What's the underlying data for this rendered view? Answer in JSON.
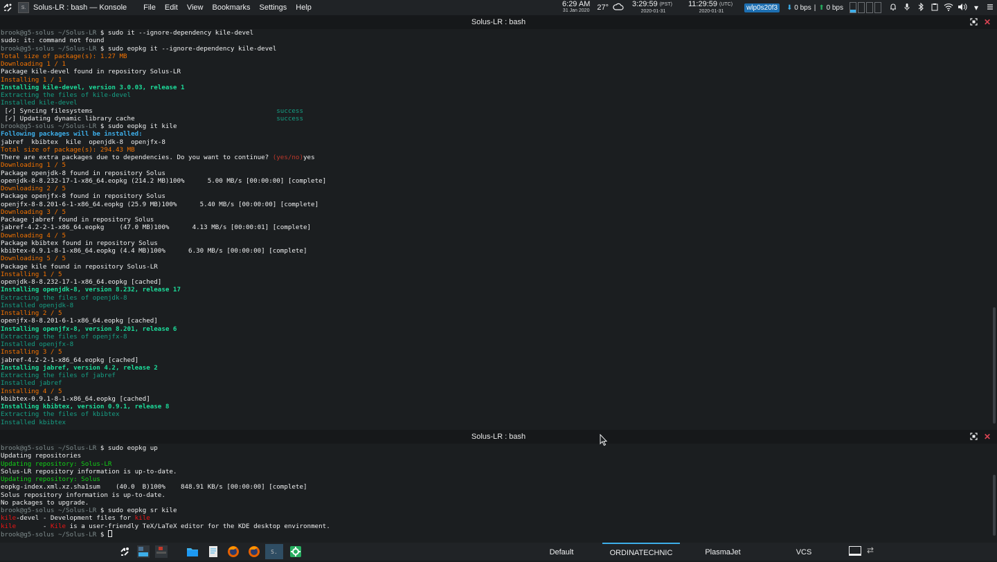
{
  "top_panel": {
    "app_badge": "S.",
    "window_title": "Solus-LR : bash — Konsole",
    "menu": [
      "File",
      "Edit",
      "View",
      "Bookmarks",
      "Settings",
      "Help"
    ],
    "clock_local": {
      "time": "6:29 AM",
      "date": "31 Jan 2020"
    },
    "temperature": "27°",
    "clock_pst": {
      "time": "3:29:59",
      "tz": "(PST)",
      "date": "2020-01-31"
    },
    "clock_utc": {
      "time": "11:29:59",
      "tz": "(UTC)",
      "date": "2020-01-31"
    },
    "interface": "wlp0s20f3",
    "down_speed": "0 bps",
    "separator": "|",
    "up_speed": "0 bps",
    "meters": [
      0.3,
      0.0,
      0.0,
      0.0
    ]
  },
  "pane1": {
    "title": "Solus-LR : bash",
    "lines": [
      [
        {
          "c": "gray",
          "t": "brook@g5-solus"
        },
        {
          "c": "gray",
          "t": " ~/Solus-LR "
        },
        {
          "c": "white",
          "t": "$ sudo it --ignore-dependency kile-devel"
        }
      ],
      [
        {
          "c": "white",
          "t": "sudo: it: command not found"
        }
      ],
      [
        {
          "c": "gray",
          "t": "brook@g5-solus"
        },
        {
          "c": "gray",
          "t": " ~/Solus-LR "
        },
        {
          "c": "white",
          "t": "$ sudo eopkg it --ignore-dependency kile-devel"
        }
      ],
      [
        {
          "c": "orange",
          "t": "Total size of package(s): 1.27 MB"
        }
      ],
      [
        {
          "c": "orange",
          "t": "Downloading 1 / 1"
        }
      ],
      [
        {
          "c": "white",
          "t": "Package kile-devel found in repository Solus-LR"
        }
      ],
      [
        {
          "c": "orange",
          "t": "Installing 1 / 1"
        }
      ],
      [
        {
          "c": "green",
          "t": "Installing kile-devel, version 3.0.03, release 1"
        }
      ],
      [
        {
          "c": "teal",
          "t": "Extracting the files of kile-devel"
        }
      ],
      [
        {
          "c": "teal",
          "t": "Installed kile-devel"
        }
      ],
      [
        {
          "c": "white",
          "t": " [✓] Syncing filesystems                                                "
        },
        {
          "c": "teal",
          "t": "success"
        }
      ],
      [
        {
          "c": "white",
          "t": " [✓] Updating dynamic library cache                                     "
        },
        {
          "c": "teal",
          "t": "success"
        }
      ],
      [
        {
          "c": "gray",
          "t": "brook@g5-solus"
        },
        {
          "c": "gray",
          "t": " ~/Solus-LR "
        },
        {
          "c": "white",
          "t": "$ sudo eopkg it kile"
        }
      ],
      [
        {
          "c": "blue",
          "t": "Following packages will be installed:"
        }
      ],
      [
        {
          "c": "white",
          "t": "jabref  kbibtex  kile  openjdk-8  openjfx-8"
        }
      ],
      [
        {
          "c": "orange",
          "t": "Total size of package(s): 294.43 MB"
        }
      ],
      [
        {
          "c": "white",
          "t": "There are extra packages due to dependencies. Do you want to continue? "
        },
        {
          "c": "red",
          "t": "(yes/no)"
        },
        {
          "c": "white",
          "t": "yes"
        }
      ],
      [
        {
          "c": "orange",
          "t": "Downloading 1 / 5"
        }
      ],
      [
        {
          "c": "white",
          "t": "Package openjdk-8 found in repository Solus"
        }
      ],
      [
        {
          "c": "white",
          "t": "openjdk-8-8.232-17-1-x86_64.eopkg (214.2 MB)100%      5.00 MB/s [00:00:00] [complete]"
        }
      ],
      [
        {
          "c": "orange",
          "t": "Downloading 2 / 5"
        }
      ],
      [
        {
          "c": "white",
          "t": "Package openjfx-8 found in repository Solus"
        }
      ],
      [
        {
          "c": "white",
          "t": "openjfx-8-8.201-6-1-x86_64.eopkg (25.9 MB)100%      5.40 MB/s [00:00:00] [complete]"
        }
      ],
      [
        {
          "c": "orange",
          "t": "Downloading 3 / 5"
        }
      ],
      [
        {
          "c": "white",
          "t": "Package jabref found in repository Solus"
        }
      ],
      [
        {
          "c": "white",
          "t": "jabref-4.2-2-1-x86_64.eopkg    (47.0 MB)100%      4.13 MB/s [00:00:01] [complete]"
        }
      ],
      [
        {
          "c": "orange",
          "t": "Downloading 4 / 5"
        }
      ],
      [
        {
          "c": "white",
          "t": "Package kbibtex found in repository Solus"
        }
      ],
      [
        {
          "c": "white",
          "t": "kbibtex-0.9.1-8-1-x86_64.eopkg (4.4 MB)100%      6.30 MB/s [00:00:00] [complete]"
        }
      ],
      [
        {
          "c": "orange",
          "t": "Downloading 5 / 5"
        }
      ],
      [
        {
          "c": "white",
          "t": "Package kile found in repository Solus-LR"
        }
      ],
      [
        {
          "c": "orange",
          "t": "Installing 1 / 5"
        }
      ],
      [
        {
          "c": "white",
          "t": "openjdk-8-8.232-17-1-x86_64.eopkg [cached]"
        }
      ],
      [
        {
          "c": "green",
          "t": "Installing openjdk-8, version 8.232, release 17"
        }
      ],
      [
        {
          "c": "teal",
          "t": "Extracting the files of openjdk-8"
        }
      ],
      [
        {
          "c": "teal",
          "t": "Installed openjdk-8"
        }
      ],
      [
        {
          "c": "orange",
          "t": "Installing 2 / 5"
        }
      ],
      [
        {
          "c": "white",
          "t": "openjfx-8-8.201-6-1-x86_64.eopkg [cached]"
        }
      ],
      [
        {
          "c": "green",
          "t": "Installing openjfx-8, version 8.201, release 6"
        }
      ],
      [
        {
          "c": "teal",
          "t": "Extracting the files of openjfx-8"
        }
      ],
      [
        {
          "c": "teal",
          "t": "Installed openjfx-8"
        }
      ],
      [
        {
          "c": "orange",
          "t": "Installing 3 / 5"
        }
      ],
      [
        {
          "c": "white",
          "t": "jabref-4.2-2-1-x86_64.eopkg [cached]"
        }
      ],
      [
        {
          "c": "green",
          "t": "Installing jabref, version 4.2, release 2"
        }
      ],
      [
        {
          "c": "teal",
          "t": "Extracting the files of jabref"
        }
      ],
      [
        {
          "c": "teal",
          "t": "Installed jabref"
        }
      ],
      [
        {
          "c": "orange",
          "t": "Installing 4 / 5"
        }
      ],
      [
        {
          "c": "white",
          "t": "kbibtex-0.9.1-8-1-x86_64.eopkg [cached]"
        }
      ],
      [
        {
          "c": "green",
          "t": "Installing kbibtex, version 0.9.1, release 8"
        }
      ],
      [
        {
          "c": "teal",
          "t": "Extracting the files of kbibtex"
        }
      ],
      [
        {
          "c": "teal",
          "t": "Installed kbibtex"
        }
      ]
    ]
  },
  "pane2": {
    "title": "Solus-LR : bash",
    "lines": [
      [
        {
          "c": "gray",
          "t": "brook@g5-solus"
        },
        {
          "c": "gray",
          "t": " ~/Solus-LR "
        },
        {
          "c": "white",
          "t": "$ sudo eopkg up"
        }
      ],
      [
        {
          "c": "white",
          "t": "Updating repositories"
        }
      ],
      [
        {
          "c": "lime",
          "t": "Updating repository: Solus-LR"
        }
      ],
      [
        {
          "c": "white",
          "t": "Solus-LR repository information is up-to-date."
        }
      ],
      [
        {
          "c": "lime",
          "t": "Updating repository: Solus"
        }
      ],
      [
        {
          "c": "white",
          "t": "eopkg-index.xml.xz.sha1sum    (40.0  B)100%    848.91 KB/s [00:00:00] [complete]"
        }
      ],
      [
        {
          "c": "white",
          "t": "Solus repository information is up-to-date."
        }
      ],
      [
        {
          "c": "white",
          "t": "No packages to upgrade."
        }
      ],
      [
        {
          "c": "gray",
          "t": "brook@g5-solus"
        },
        {
          "c": "gray",
          "t": " ~/Solus-LR "
        },
        {
          "c": "white",
          "t": "$ sudo eopkg sr kile"
        }
      ],
      [
        {
          "c": "brightred",
          "t": "kile"
        },
        {
          "c": "white",
          "t": "-devel - Development files for "
        },
        {
          "c": "brightred",
          "t": "kile"
        }
      ],
      [
        {
          "c": "brightred",
          "t": "kile"
        },
        {
          "c": "white",
          "t": "       - "
        },
        {
          "c": "brightred",
          "t": "Kile"
        },
        {
          "c": "white",
          "t": " is a user-friendly TeX/LaTeX editor for the KDE desktop environment."
        }
      ],
      [
        {
          "c": "gray",
          "t": "brook@g5-solus"
        },
        {
          "c": "gray",
          "t": " ~/Solus-LR "
        },
        {
          "c": "white",
          "t": "$ "
        },
        {
          "c": "cursor",
          "t": ""
        }
      ]
    ]
  },
  "bottom_panel": {
    "tasks": [
      {
        "name": "application-launcher-task",
        "icon": "kde-logo-icon"
      },
      {
        "name": "pager-task",
        "icon": "desktop-pager-icon"
      },
      {
        "name": "pager-task-2",
        "icon": "desktop-pager-icon"
      },
      {
        "name": "dolphin-task",
        "icon": "folder-icon"
      },
      {
        "name": "kate-task",
        "icon": "text-editor-icon"
      },
      {
        "name": "firefox-task",
        "icon": "firefox-icon"
      },
      {
        "name": "firefox-dev-task",
        "icon": "firefox-icon"
      },
      {
        "name": "konsole-task",
        "icon": "terminal-icon"
      },
      {
        "name": "settings-task",
        "icon": "gear-icon"
      }
    ],
    "konsole_badge": "S.",
    "desktops": [
      "Default",
      "ORDINATECHNIC",
      "PlasmaJet",
      "VCS"
    ],
    "current_desktop": "ORDINATECHNIC"
  }
}
